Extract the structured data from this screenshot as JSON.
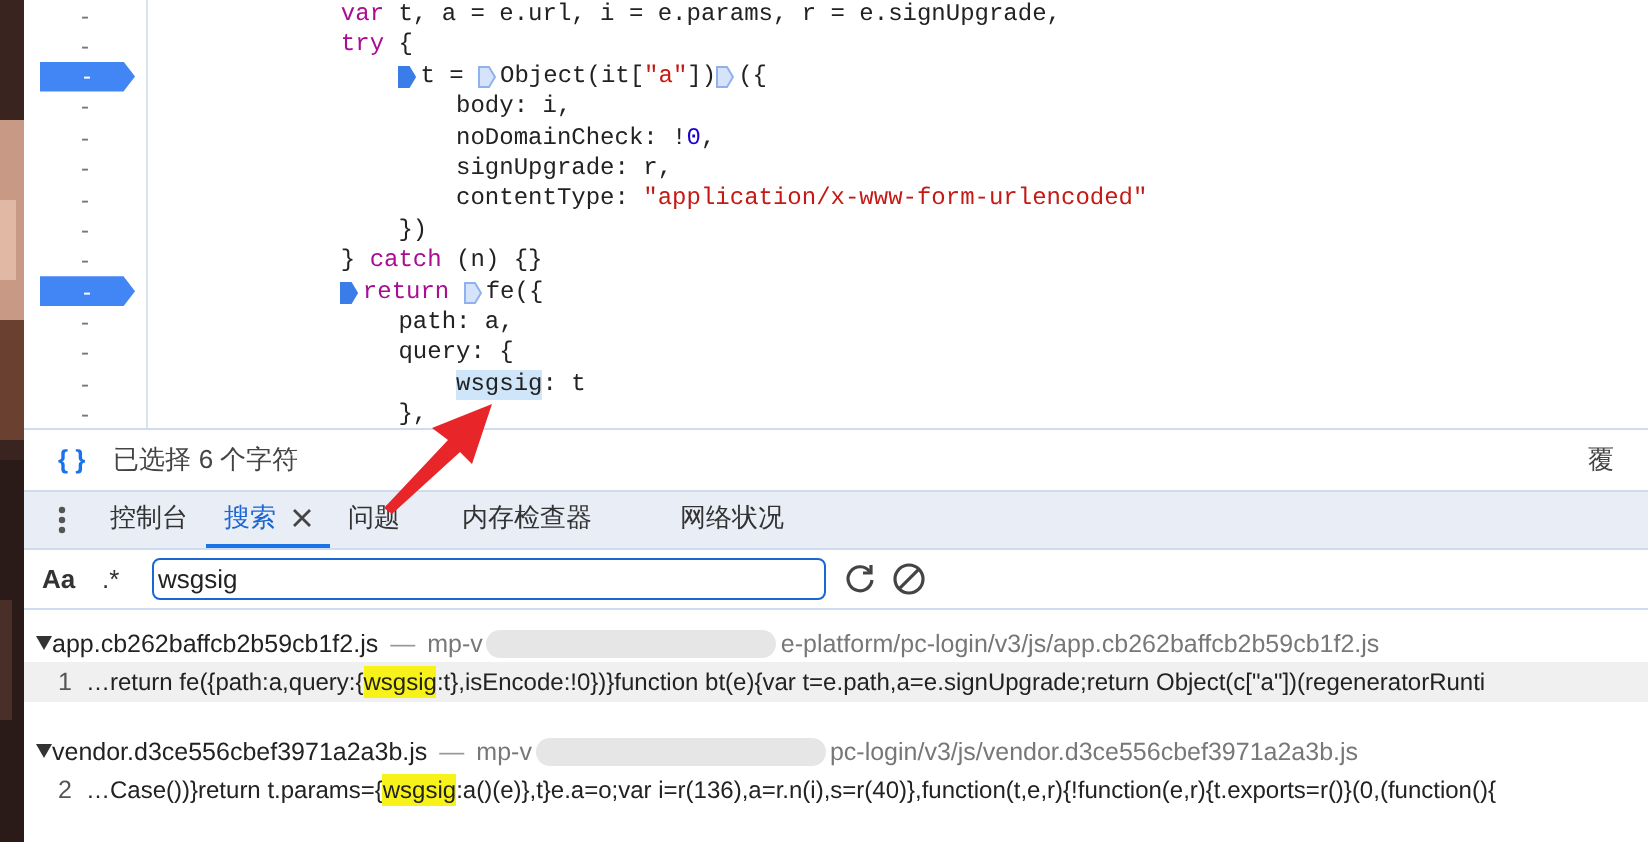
{
  "editor": {
    "lines": [
      {
        "gutter": "-",
        "breakpoint": false,
        "tokens": [
          {
            "kind": "keyword",
            "text": "            var"
          },
          {
            "kind": "plain",
            "text": " t, a = e.url, i = e.params, r = e.signUpgrade,"
          }
        ]
      },
      {
        "gutter": "-",
        "breakpoint": false,
        "tokens": [
          {
            "kind": "keyword",
            "text": "            try"
          },
          {
            "kind": "plain",
            "text": " {"
          }
        ]
      },
      {
        "gutter": "-",
        "breakpoint": true,
        "tokens": [
          {
            "kind": "plain",
            "text": "                t = ",
            "marker": true
          },
          {
            "kind": "plain",
            "text": "Object(it[",
            "marker": false
          },
          {
            "kind": "string",
            "text": "\"a\""
          },
          {
            "kind": "plain",
            "text": "])"
          },
          {
            "kind": "plain",
            "text": "({",
            "marker": false
          }
        ]
      },
      {
        "gutter": "-",
        "breakpoint": false,
        "tokens": [
          {
            "kind": "plain",
            "text": "                    body: i,"
          }
        ]
      },
      {
        "gutter": "-",
        "breakpoint": false,
        "tokens": [
          {
            "kind": "plain",
            "text": "                    noDomainCheck: !"
          },
          {
            "kind": "number",
            "text": "0"
          },
          {
            "kind": "plain",
            "text": ","
          }
        ]
      },
      {
        "gutter": "-",
        "breakpoint": false,
        "tokens": [
          {
            "kind": "plain",
            "text": "                    signUpgrade: r,"
          }
        ]
      },
      {
        "gutter": "-",
        "breakpoint": false,
        "tokens": [
          {
            "kind": "plain",
            "text": "                    contentType: "
          },
          {
            "kind": "string",
            "text": "\"application/x-www-form-urlencoded\""
          }
        ]
      },
      {
        "gutter": "-",
        "breakpoint": false,
        "tokens": [
          {
            "kind": "plain",
            "text": "                })"
          }
        ]
      },
      {
        "gutter": "-",
        "breakpoint": false,
        "tokens": [
          {
            "kind": "plain",
            "text": "            } "
          },
          {
            "kind": "keyword",
            "text": "catch"
          },
          {
            "kind": "plain",
            "text": " (n) {}"
          }
        ]
      },
      {
        "gutter": "-",
        "breakpoint": true,
        "tokens": [
          {
            "kind": "keyword",
            "text": "            return",
            "marker": true
          },
          {
            "kind": "plain",
            "text": " fe({",
            "marker": false
          }
        ]
      },
      {
        "gutter": "-",
        "breakpoint": false,
        "tokens": [
          {
            "kind": "plain",
            "text": "                path: a,"
          }
        ]
      },
      {
        "gutter": "-",
        "breakpoint": false,
        "tokens": [
          {
            "kind": "plain",
            "text": "                query: {"
          }
        ]
      },
      {
        "gutter": "-",
        "breakpoint": false,
        "tokens": [
          {
            "kind": "selected",
            "text": "                    wsgsig"
          },
          {
            "kind": "plain",
            "text": ": t"
          }
        ]
      },
      {
        "gutter": "-",
        "breakpoint": false,
        "tokens": [
          {
            "kind": "plain",
            "text": "                },"
          }
        ]
      }
    ]
  },
  "status_bar": {
    "icon_text": "{ }",
    "selection": "已选择 6 个字符",
    "right_text": "覆"
  },
  "drawer_tabs": [
    {
      "label": "控制台",
      "selected": false,
      "closable": false
    },
    {
      "label": "搜索",
      "selected": true,
      "closable": true
    },
    {
      "label": "问题",
      "selected": false,
      "closable": false
    },
    {
      "label": "内存检查器",
      "selected": false,
      "closable": false
    },
    {
      "label": "网络状况",
      "selected": false,
      "closable": false
    }
  ],
  "search": {
    "case_toggle": "Aa",
    "regex_toggle": ".*",
    "value": "wsgsig"
  },
  "results": [
    {
      "file": "app.cb262baffcb2b59cb1f2.js",
      "separator": "—",
      "path_start": "mp-v",
      "path_end": "e-platform/pc-login/v3/js/app.cb262baffcb2b59cb1f2.js",
      "matches": [
        {
          "line": "1",
          "selected": true,
          "before": "…return fe({path:a,query:{",
          "match": "wsgsig",
          "after": ":t},isEncode:!0})}function bt(e){var t=e.path,a=e.signUpgrade;return Object(c[\"a\"])(regeneratorRunti"
        }
      ]
    },
    {
      "file": "vendor.d3ce556cbef3971a2a3b.js",
      "separator": "—",
      "path_start": "mp-v",
      "path_end": "pc-login/v3/js/vendor.d3ce556cbef3971a2a3b.js",
      "matches": [
        {
          "line": "2",
          "selected": false,
          "before": "…Case())}return t.params={",
          "match": "wsgsig",
          "after": ":a()(e)},t}e.a=o;var i=r(136),a=r.n(i),s=r(40)},function(t,e,r){!function(e,r){t.exports=r()}(0,(function(){"
        }
      ]
    }
  ]
}
